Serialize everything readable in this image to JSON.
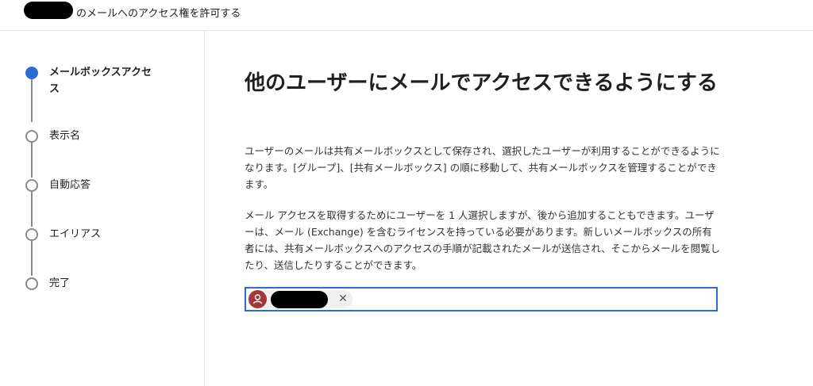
{
  "header": {
    "title": "のメールへのアクセス権を許可する"
  },
  "steps": [
    {
      "label": "メールボックスアクセス",
      "active": true
    },
    {
      "label": "表示名",
      "active": false
    },
    {
      "label": "自動応答",
      "active": false
    },
    {
      "label": "エイリアス",
      "active": false
    },
    {
      "label": "完了",
      "active": false
    }
  ],
  "main": {
    "title": "他のユーザーにメールでアクセスできるようにする",
    "paragraph1": "ユーザーのメールは共有メールボックスとして保存され、選択したユーザーが利用することができるようになります。[グループ]、[共有メールボックス] の順に移動して、共有メールボックスを管理することができます。",
    "paragraph2": "メール アクセスを取得するためにユーザーを 1 人選択しますが、後から追加することもできます。ユーザーは、メール (Exchange) を含むライセンスを持っている必要があります。新しいメールボックスの所有者には、共有メールボックスへのアクセスの手順が記載されたメールが送信され、そこからメールを閲覧したり、送信したりすることができます。"
  },
  "user_picker": {
    "remove_glyph": "✕"
  },
  "colors": {
    "accent": "#2b6cd1",
    "avatar": "#a4373a"
  }
}
